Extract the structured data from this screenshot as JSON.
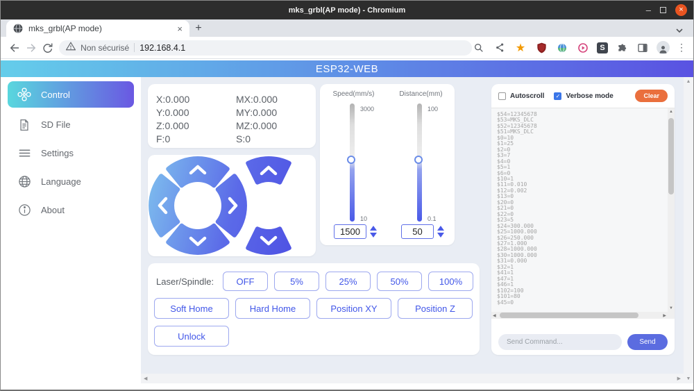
{
  "titlebar": {
    "title": "mks_grbl(AP mode) - Chromium"
  },
  "tabstrip": {
    "tab_title": "mks_grbl(AP mode)"
  },
  "toolbar": {
    "security_label": "Non sécurisé",
    "url": "192.168.4.1"
  },
  "page": {
    "header_title": "ESP32-WEB",
    "sidebar": {
      "items": [
        {
          "label": "Control"
        },
        {
          "label": "SD File"
        },
        {
          "label": "Settings"
        },
        {
          "label": "Language"
        },
        {
          "label": "About"
        }
      ]
    },
    "status": {
      "x": "X:0.000",
      "mx": "MX:0.000",
      "y": "Y:0.000",
      "my": "MY:0.000",
      "z": "Z:0.000",
      "mz": "MZ:0.000",
      "f": "F:0",
      "s": "S:0"
    },
    "speed": {
      "label": "Speed(mm/s)",
      "max": "3000",
      "min": "10",
      "value": "1500"
    },
    "distance": {
      "label": "Distance(mm)",
      "max": "100",
      "min": "0.1",
      "value": "50"
    },
    "laser": {
      "label": "Laser/Spindle:",
      "off": "OFF",
      "p5": "5%",
      "p25": "25%",
      "p50": "50%",
      "p100": "100%"
    },
    "actions": {
      "soft_home": "Soft Home",
      "hard_home": "Hard Home",
      "position_xy": "Position XY",
      "position_z": "Position Z",
      "unlock": "Unlock"
    },
    "console": {
      "autoscroll_label": "Autoscroll",
      "verbose_label": "Verbose mode",
      "clear_label": "Clear",
      "lines": [
        "$54=12345678",
        "$53=MKS_DLC",
        "$52=12345678",
        "$51=MKS_DLC",
        "$0=10",
        "$1=25",
        "$2=0",
        "$3=7",
        "$4=0",
        "$5=1",
        "$6=0",
        "$10=1",
        "$11=0.010",
        "$12=0.002",
        "$13=0",
        "$20=0",
        "$21=0",
        "$22=0",
        "$23=5",
        "$24=300.000",
        "$25=1000.000",
        "$26=250.000",
        "$27=1.000",
        "$28=1000.000",
        "$30=1000.000",
        "$31=0.000",
        "$32=1",
        "$41=1",
        "$47=1",
        "$46=1",
        "$102=100",
        "$101=80",
        "$45=0"
      ],
      "send_placeholder": "Send Command...",
      "send_label": "Send"
    }
  },
  "icons": {
    "minimize": "–",
    "close": "×",
    "tab_close": "×",
    "new_tab": "+",
    "star": "★",
    "s_badge": "S",
    "menu_dots": "⋮",
    "check": "✓",
    "arrow_up": "▲",
    "arrow_down": "▼",
    "arrow_left": "◀",
    "arrow_right": "▶"
  },
  "colors": {
    "header_gradient_start": "#64cdea",
    "header_gradient_end": "#5a52e2",
    "active_item_gradient_start": "#59d7de",
    "active_item_gradient_end": "#6a58e2",
    "pad_gradient_start": "#7fc1ee",
    "pad_gradient_end": "#4d4fe3",
    "button_blue": "#4156e8",
    "button_border": "#9da8ef",
    "clear_orange": "#ea6f3d",
    "send_blue": "#5b6ce0",
    "checkbox_blue": "#3b76e8",
    "close_button_orange": "#e95420",
    "bookmark_star": "#f29900"
  }
}
